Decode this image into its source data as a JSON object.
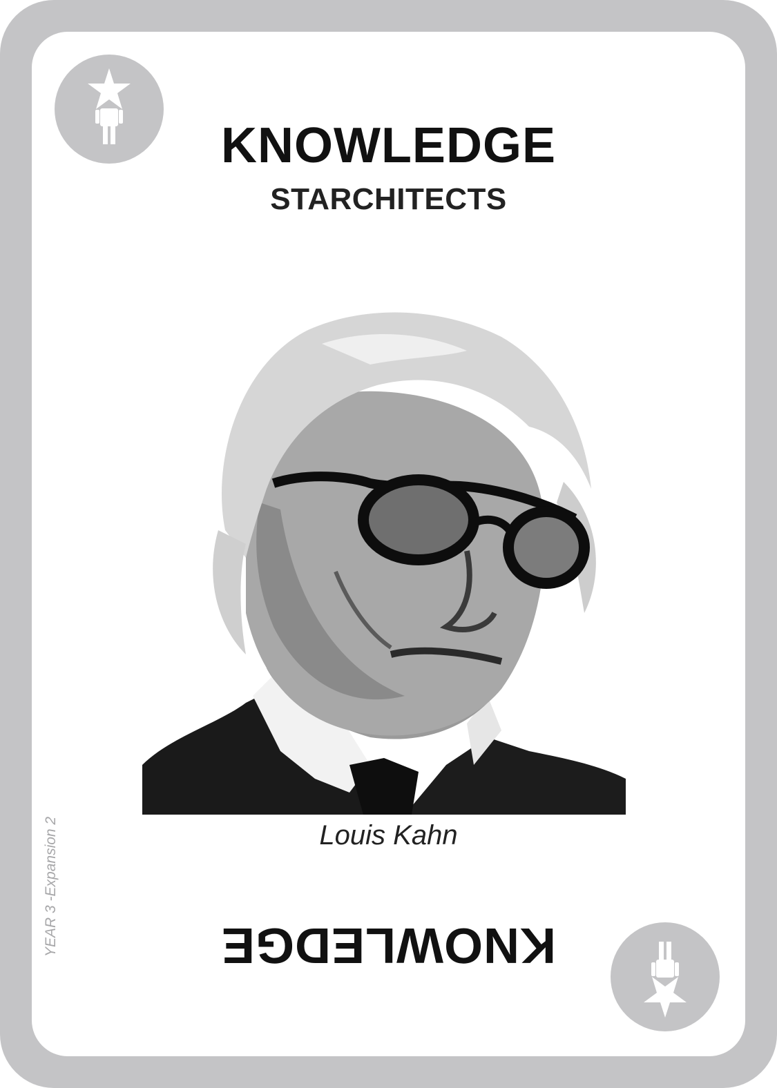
{
  "card": {
    "title": "KNOWLEDGE",
    "subtitle": "STARCHITECTS",
    "person_name": "Louis Kahn",
    "title_flipped": "KNOWLEDGE",
    "edition": "YEAR 3 -Expansion 2"
  },
  "icons": {
    "top_badge": "star-person-icon",
    "bottom_badge": "star-person-icon"
  },
  "colors": {
    "frame": "#c4c4c6",
    "text": "#111111",
    "edition_text": "#a7a7a9"
  }
}
